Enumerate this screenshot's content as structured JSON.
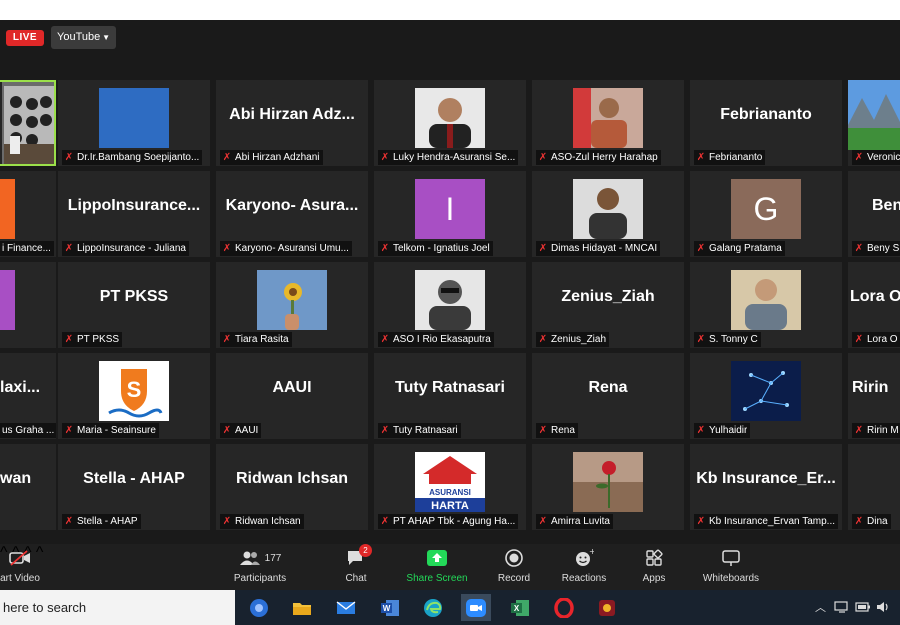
{
  "live": {
    "badge": "LIVE",
    "platform": "YouTube"
  },
  "tiles": [
    {
      "id": "r1c0",
      "kind": "video-self",
      "name": ""
    },
    {
      "id": "r1c1",
      "kind": "photo",
      "big": "",
      "name": "Dr.Ir.Bambang Soepijanto..."
    },
    {
      "id": "r1c2",
      "kind": "text",
      "big": "Abi  Hirzan  Adz...",
      "name": "Abi Hirzan Adzhani"
    },
    {
      "id": "r1c3",
      "kind": "photo",
      "big": "",
      "name": "Luky Hendra-Asuransi Se..."
    },
    {
      "id": "r1c4",
      "kind": "photo",
      "big": "",
      "name": "ASO-Zul Herry Harahap"
    },
    {
      "id": "r1c5",
      "kind": "text",
      "big": "Febriananto",
      "name": "Febriananto"
    },
    {
      "id": "r1c6",
      "kind": "photo",
      "big": "",
      "name": "Veronica"
    },
    {
      "id": "r2c0",
      "kind": "photo",
      "big": "",
      "name": "i Finance..."
    },
    {
      "id": "r2c1",
      "kind": "text",
      "big": "LippoInsurance...",
      "name": "LippoInsurance - Juliana"
    },
    {
      "id": "r2c2",
      "kind": "text",
      "big": "Karyono-  Asura...",
      "name": "Karyono- Asuransi Umu..."
    },
    {
      "id": "r2c3",
      "kind": "letter",
      "big": "I",
      "name": "Telkom - Ignatius Joel"
    },
    {
      "id": "r2c4",
      "kind": "photo",
      "big": "",
      "name": "Dimas Hidayat - MNCAI"
    },
    {
      "id": "r2c5",
      "kind": "letter",
      "big": "G",
      "name": "Galang Pratama"
    },
    {
      "id": "r2c6",
      "kind": "text",
      "big": "Ben",
      "name": "Beny S"
    },
    {
      "id": "r3c0",
      "kind": "photo",
      "big": "",
      "name": ""
    },
    {
      "id": "r3c1",
      "kind": "text",
      "big": "PT PKSS",
      "name": "PT PKSS"
    },
    {
      "id": "r3c2",
      "kind": "photo",
      "big": "",
      "name": "Tiara Rasita"
    },
    {
      "id": "r3c3",
      "kind": "photo",
      "big": "",
      "name": "ASO I Rio Ekasaputra"
    },
    {
      "id": "r3c4",
      "kind": "text",
      "big": "Zenius_Ziah",
      "name": "Zenius_Ziah"
    },
    {
      "id": "r3c5",
      "kind": "photo",
      "big": "",
      "name": "S. Tonny C"
    },
    {
      "id": "r3c6",
      "kind": "text",
      "big": "Lora O",
      "name": "Lora O"
    },
    {
      "id": "r4c0",
      "kind": "text",
      "big": "laxi...",
      "name": "us Graha ..."
    },
    {
      "id": "r4c1",
      "kind": "photo",
      "big": "",
      "name": "Maria - Seainsure"
    },
    {
      "id": "r4c2",
      "kind": "text",
      "big": "AAUI",
      "name": "AAUI"
    },
    {
      "id": "r4c3",
      "kind": "text",
      "big": "Tuty Ratnasari",
      "name": "Tuty Ratnasari"
    },
    {
      "id": "r4c4",
      "kind": "text",
      "big": "Rena",
      "name": "Rena"
    },
    {
      "id": "r4c5",
      "kind": "photo",
      "big": "",
      "name": "Yulhaidir"
    },
    {
      "id": "r4c6",
      "kind": "text",
      "big": "Ririn",
      "name": "Ririn M"
    },
    {
      "id": "r5c0",
      "kind": "text",
      "big": "wan",
      "name": ""
    },
    {
      "id": "r5c1",
      "kind": "text",
      "big": "Stella - AHAP",
      "name": "Stella - AHAP"
    },
    {
      "id": "r5c2",
      "kind": "text",
      "big": "Ridwan Ichsan",
      "name": "Ridwan Ichsan"
    },
    {
      "id": "r5c3",
      "kind": "photo",
      "big": "",
      "name": "PT AHAP Tbk - Agung Ha..."
    },
    {
      "id": "r5c4",
      "kind": "photo",
      "big": "",
      "name": "Amirra Luvita"
    },
    {
      "id": "r5c5",
      "kind": "text",
      "big": "Kb  Insurance_Er...",
      "name": "Kb Insurance_Ervan Tamp..."
    },
    {
      "id": "r5c6",
      "kind": "text",
      "big": "",
      "name": "Dina"
    }
  ],
  "logo_text": {
    "asuransi": "ASURANSI",
    "harta": "HARTA"
  },
  "toolbar": {
    "start_video": "art Video",
    "participants": "Participants",
    "participants_count": "177",
    "chat": "Chat",
    "chat_badge": "2",
    "share_screen": "Share Screen",
    "record": "Record",
    "reactions": "Reactions",
    "apps": "Apps",
    "whiteboards": "Whiteboards"
  },
  "taskbar": {
    "search_placeholder": "here to search"
  },
  "colors": {
    "accent_green": "#23d959",
    "live_red": "#e02828",
    "mute_red": "#e33333",
    "taskbar_bg": "#18222e"
  }
}
